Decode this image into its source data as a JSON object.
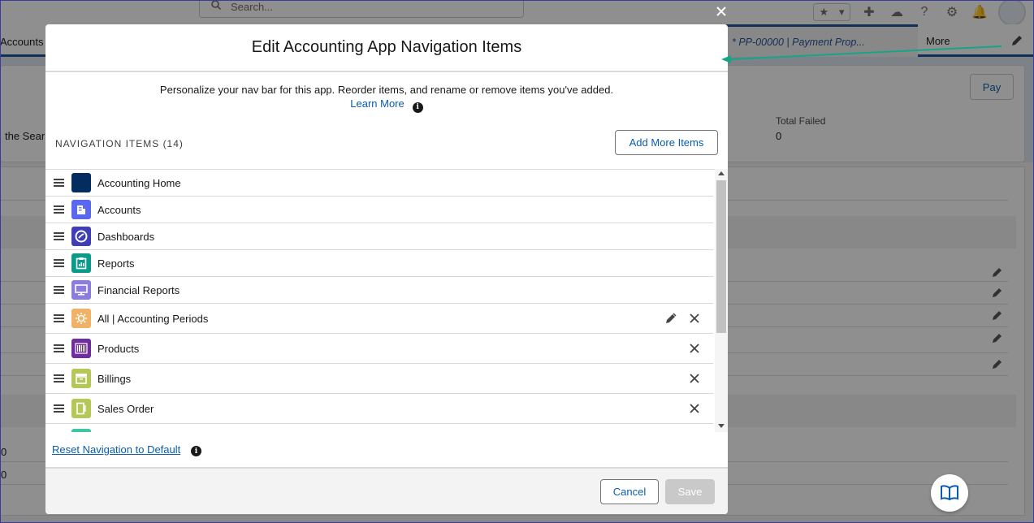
{
  "background": {
    "search_placeholder": "Search...",
    "accounts_tab": "Accounts",
    "payment_tab": "* PP-00000 | Payment Prop...",
    "more_tab": "More",
    "pay_button": "Pay",
    "search_fragment": "the Sear",
    "total_failed_label": "Total Failed",
    "total_failed_value": "0",
    "zero_a": "0",
    "zero_b": "0"
  },
  "modal": {
    "title": "Edit Accounting App Navigation Items",
    "intro": "Personalize your nav bar for this app. Reorder items, and rename or remove items you've added.",
    "learn_more": "Learn More",
    "section_label": "NAVIGATION ITEMS (14)",
    "add_more": "Add More Items",
    "items": [
      {
        "label": "Accounting Home",
        "icon": "home-square-icon",
        "color": "#032d60"
      },
      {
        "label": "Accounts",
        "icon": "building-icon",
        "color": "#5a67ef"
      },
      {
        "label": "Dashboards",
        "icon": "gauge-icon",
        "color": "#3e3eb8"
      },
      {
        "label": "Reports",
        "icon": "clipboard-icon",
        "color": "#0b9b8a"
      },
      {
        "label": "Financial Reports",
        "icon": "monitor-icon",
        "color": "#8c7ce0"
      },
      {
        "label": "All | Accounting Periods",
        "icon": "gear-sun-icon",
        "color": "#f0b266"
      },
      {
        "label": "Products",
        "icon": "barcode-icon",
        "color": "#6f2d9e"
      },
      {
        "label": "Billings",
        "icon": "archive-icon",
        "color": "#b5c857"
      },
      {
        "label": "Sales Order",
        "icon": "tablet-icon",
        "color": "#b5c857"
      },
      {
        "label": "",
        "icon": "partial-icon",
        "color": "#3fc6a0"
      }
    ],
    "reset": "Reset Navigation to Default",
    "cancel": "Cancel",
    "save": "Save"
  }
}
